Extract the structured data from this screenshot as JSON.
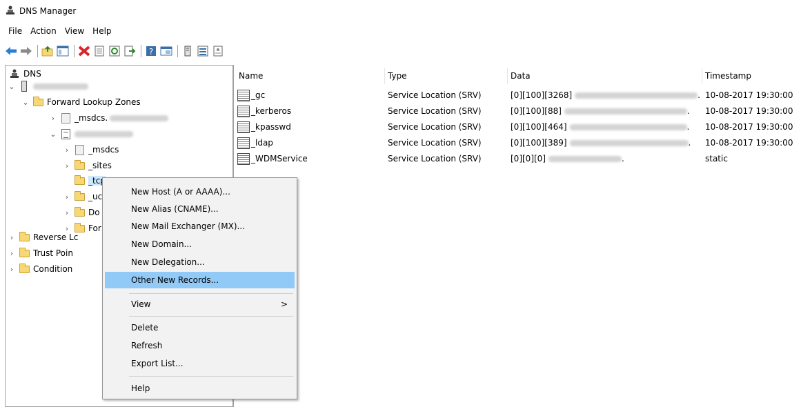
{
  "window": {
    "title": "DNS Manager"
  },
  "menubar": [
    "File",
    "Action",
    "View",
    "Help"
  ],
  "toolbar_icons": [
    "back-icon",
    "forward-icon",
    "up-folder-icon",
    "show-hide-tree-icon",
    "delete-icon",
    "properties-icon",
    "refresh-icon",
    "export-list-icon",
    "help-icon",
    "console-icon",
    "host-record-icon",
    "list-view-icon",
    "details-icon"
  ],
  "tree": {
    "root": "DNS",
    "forward_lookup_zones": "Forward Lookup Zones",
    "msdcs_zone": "_msdcs.",
    "msdcs": "_msdcs",
    "sites": "_sites",
    "tcp": "_tcp",
    "udp": "_uc",
    "domain_dns_zones": "Do",
    "forest_dns_zones": "For",
    "reverse": "Reverse Lc",
    "trust": "Trust Poin",
    "conditional": "Condition"
  },
  "list": {
    "columns": [
      "Name",
      "Type",
      "Data",
      "Timestamp"
    ],
    "rows": [
      {
        "name": "_gc",
        "type": "Service Location (SRV)",
        "data": "[0][100][3268]",
        "data_suffix": ".",
        "timestamp": "10-08-2017 19:30:00"
      },
      {
        "name": "_kerberos",
        "type": "Service Location (SRV)",
        "data": "[0][100][88]",
        "data_suffix": ".",
        "timestamp": "10-08-2017 19:30:00"
      },
      {
        "name": "_kpasswd",
        "type": "Service Location (SRV)",
        "data": "[0][100][464]",
        "data_suffix": ".",
        "timestamp": "10-08-2017 19:30:00"
      },
      {
        "name": "_ldap",
        "type": "Service Location (SRV)",
        "data": "[0][100][389]",
        "data_suffix": ".",
        "timestamp": "10-08-2017 19:30:00"
      },
      {
        "name": "_WDMService",
        "type": "Service Location (SRV)",
        "data": "[0][0][0]",
        "data_suffix": ".",
        "timestamp": "static"
      }
    ]
  },
  "context_menu": {
    "new_host": "New Host (A or AAAA)...",
    "new_alias": "New Alias (CNAME)...",
    "new_mx": "New Mail Exchanger (MX)...",
    "new_domain": "New Domain...",
    "new_delegation": "New Delegation...",
    "other_new_records": "Other New Records...",
    "view": "View",
    "view_arrow": ">",
    "delete": "Delete",
    "refresh": "Refresh",
    "export_list": "Export List...",
    "help": "Help"
  },
  "colors": {
    "highlight": "#91c9f7",
    "folder": "#f8d775"
  }
}
